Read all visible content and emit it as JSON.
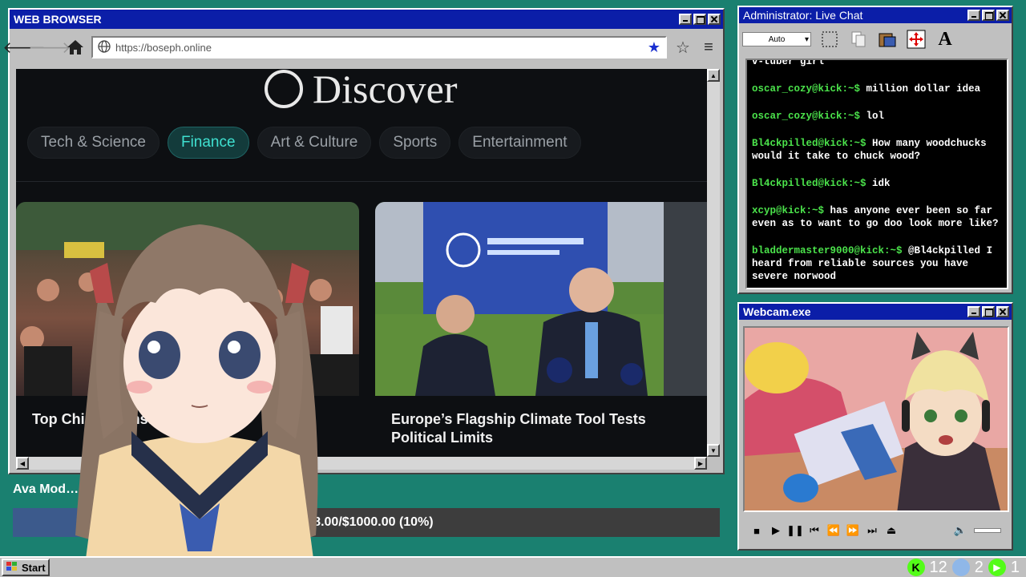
{
  "browser": {
    "title": "WEB BROWSER",
    "url": "https://boseph.online",
    "page": {
      "heading": "Discover",
      "tabs": [
        "Tech & Science",
        "Finance",
        "Art & Culture",
        "Sports",
        "Entertainment"
      ],
      "active_tab": "Finance",
      "cards": [
        {
          "headline": "Top Chin… Cons…"
        },
        {
          "headline": "Europe’s Flagship Climate Tool Tests Political Limits"
        }
      ]
    }
  },
  "goal": {
    "label": "Ava Mod…",
    "text": "$98.00/$1000.00 (10%)",
    "progress": 0.098
  },
  "chat": {
    "title": "Administrator: Live Chat",
    "zoom": "Auto",
    "partial_top": "v-tuber girl",
    "messages": [
      {
        "user": "oscar_cozy@kick:~$",
        "text": "million dollar idea"
      },
      {
        "user": "oscar_cozy@kick:~$",
        "text": "lol"
      },
      {
        "user": "Bl4ckpilled@kick:~$",
        "text": "How many woodchucks would it take to chuck wood?"
      },
      {
        "user": "Bl4ckpilled@kick:~$",
        "text": "idk"
      },
      {
        "user": "xcyp@kick:~$",
        "text": "has anyone ever been so far even as to want to go doo look more like?"
      },
      {
        "user": "bladdermaster9000@kick:~$",
        "text": "@Bl4ckpilled I heard from reliable sources you have severe norwood"
      }
    ]
  },
  "webcam": {
    "title": "Webcam.exe"
  },
  "taskbar": {
    "start_label": "Start",
    "tray": [
      {
        "icon": "kick-icon",
        "color": "#53fc18",
        "count": "12"
      },
      {
        "icon": "moon-icon",
        "color": "#8fb7e8",
        "count": "2"
      },
      {
        "icon": "play-icon",
        "color": "#53fc18",
        "count": "1"
      }
    ]
  },
  "colors": {
    "desktop": "#1a8070",
    "titlebar": "#0b1ea8",
    "accent": "#3fe0d0",
    "chat_user": "#4be34b"
  }
}
